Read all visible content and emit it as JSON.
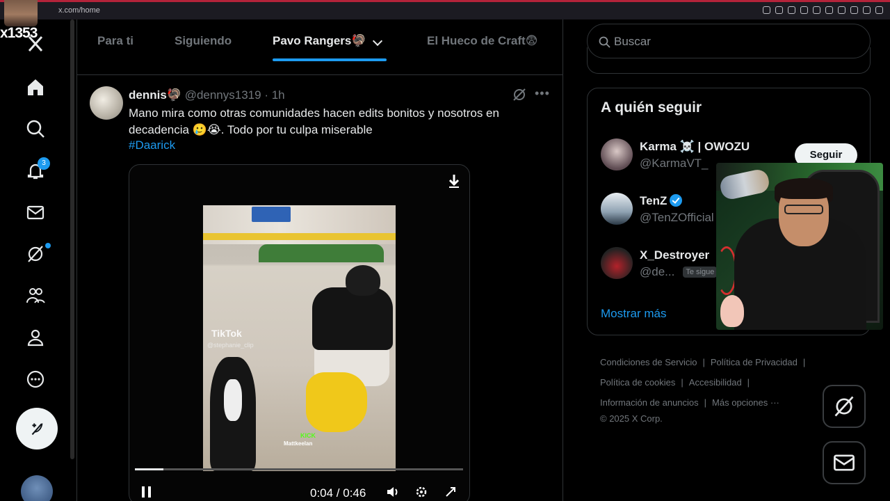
{
  "browser": {
    "url": "x.com/home"
  },
  "overlay": {
    "stream_tag": "x1353"
  },
  "sidebar": {
    "notifications_count": "3"
  },
  "tabs": [
    {
      "label": "Para ti"
    },
    {
      "label": "Siguiendo"
    },
    {
      "label": "Pavo Rangers🦃"
    },
    {
      "label": "El Hueco de Craft😨"
    }
  ],
  "tweet": {
    "name": "dennis🦃",
    "handle": "@dennys1319",
    "time": "· 1h",
    "text": "Mano mira como otras comunidades hacen edits bonitos y nosotros en decadencia 🥲😭. Todo por tu culpa miserable",
    "hashtag": "#Daarick",
    "video": {
      "watermark": "TikTok",
      "watermark_handle": "@stephanie_clip",
      "kick_label": "KICK",
      "kick_name": "Mattkeelan",
      "progress": 0.087,
      "time": "0:04 / 0:46"
    }
  },
  "search": {
    "placeholder": "Buscar"
  },
  "who_to_follow": {
    "title": "A quién seguir",
    "follow_label": "Seguir",
    "accounts": [
      {
        "name": "Karma ☠️ | OWOZU",
        "handle": "@KarmaVT_"
      },
      {
        "name": "TenZ",
        "handle": "@TenZOfficial",
        "verified": true
      },
      {
        "name": "X_Destroyer",
        "handle": "@de...",
        "follows_you": "Te sigue"
      }
    ],
    "show_more": "Mostrar más"
  },
  "footer": {
    "links": [
      "Condiciones de Servicio",
      "Política de Privacidad",
      "Política de cookies",
      "Accesibilidad",
      "Información de anuncios",
      "Más opciones ···"
    ],
    "copyright": "© 2025 X Corp."
  },
  "colors": {
    "accent": "#1d9bf0",
    "background": "#000000",
    "muted": "#71767b"
  }
}
